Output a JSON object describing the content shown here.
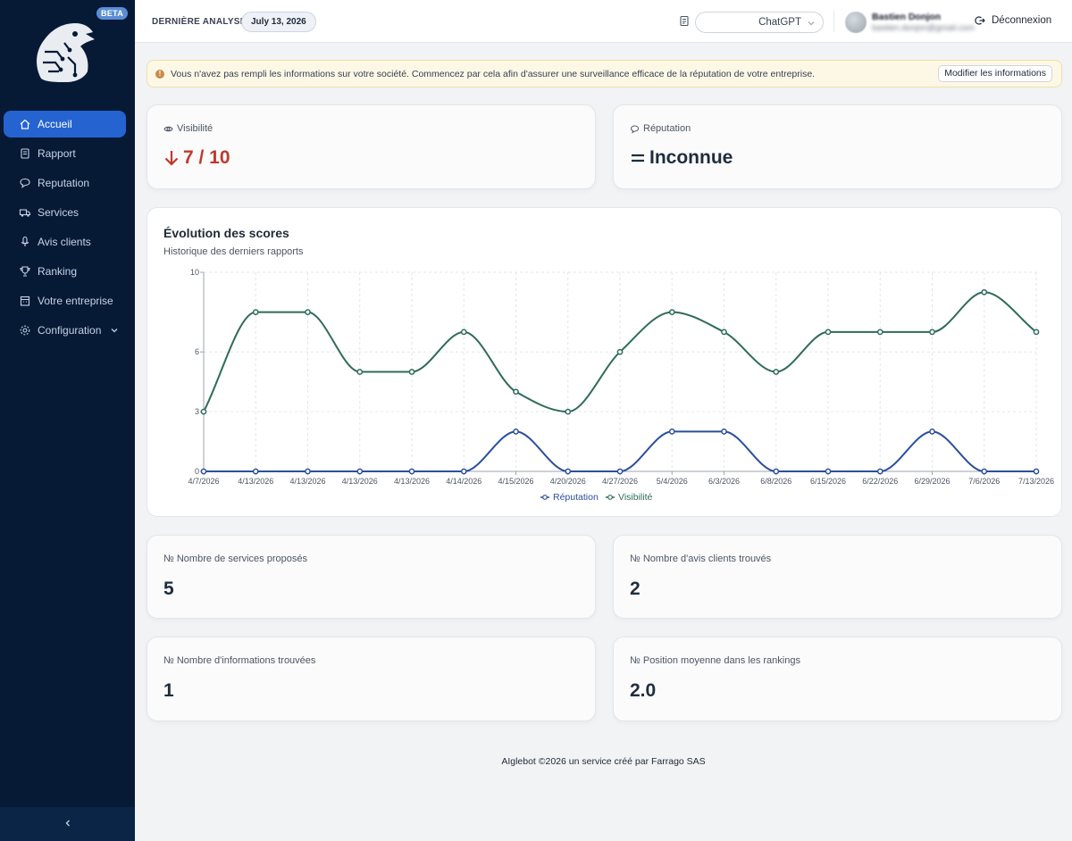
{
  "sidebar": {
    "beta": "BETA",
    "items": [
      {
        "label": "Accueil",
        "icon": "home-icon",
        "active": true
      },
      {
        "label": "Rapport",
        "icon": "report-icon"
      },
      {
        "label": "Reputation",
        "icon": "chat-icon"
      },
      {
        "label": "Services",
        "icon": "truck-icon"
      },
      {
        "label": "Avis clients",
        "icon": "mic-icon"
      },
      {
        "label": "Ranking",
        "icon": "trophy-icon"
      },
      {
        "label": "Votre entreprise",
        "icon": "building-icon"
      },
      {
        "label": "Configuration",
        "icon": "gear-icon"
      }
    ],
    "collapse_icon": "chevron-left-icon"
  },
  "topbar": {
    "last_label": "DERNIÈRE ANALYSE",
    "date": "July 13, 2026",
    "model": "ChatGPT",
    "user_name": "Bastien Donjon",
    "user_email": "bastien.donjon@gmail.com",
    "logout": "Déconnexion"
  },
  "alert": {
    "message": "Vous n'avez pas rempli les informations sur votre société. Commencez par cela afin d'assurer une surveillance efficace de la réputation de votre entreprise.",
    "button": "Modifier les informations"
  },
  "cards": {
    "visibility_label": "Visibilité",
    "visibility_value": "7 / 10",
    "reputation_label": "Réputation",
    "reputation_value": "Inconnue",
    "services_label": "№ Nombre de services proposés",
    "services_value": "5",
    "reviews_label": "№ Nombre d'avis clients trouvés",
    "reviews_value": "2",
    "infos_label": "№ Nombre d'informations trouvées",
    "infos_value": "1",
    "ranking_label": "№ Position moyenne dans les rankings",
    "ranking_value": "2.0"
  },
  "chart": {
    "title": "Évolution des scores",
    "subtitle": "Historique des derniers rapports"
  },
  "chart_data": {
    "type": "line",
    "x": [
      "4/7/2026",
      "4/13/2026",
      "4/13/2026",
      "4/13/2026",
      "4/13/2026",
      "4/14/2026",
      "4/15/2026",
      "4/20/2026",
      "4/27/2026",
      "5/4/2026",
      "6/3/2026",
      "6/8/2026",
      "6/15/2026",
      "6/22/2026",
      "6/29/2026",
      "7/6/2026",
      "7/13/2026"
    ],
    "yticks": [
      0,
      3,
      6,
      10
    ],
    "ylim": [
      0,
      10
    ],
    "series": [
      {
        "name": "Réputation",
        "color": "#2b4f9e",
        "values": [
          0,
          0,
          0,
          0,
          0,
          0,
          2,
          0,
          0,
          2,
          2,
          0,
          0,
          0,
          2,
          0,
          0
        ]
      },
      {
        "name": "Visibilité",
        "color": "#2e6b5a",
        "values": [
          3,
          8,
          8,
          5,
          5,
          7,
          4,
          3,
          6,
          8,
          7,
          5,
          7,
          7,
          7,
          9,
          7
        ]
      }
    ],
    "grid": true,
    "legend": "bottom"
  },
  "footer": "AIglebot ©2026 un service créé par Farrago SAS"
}
